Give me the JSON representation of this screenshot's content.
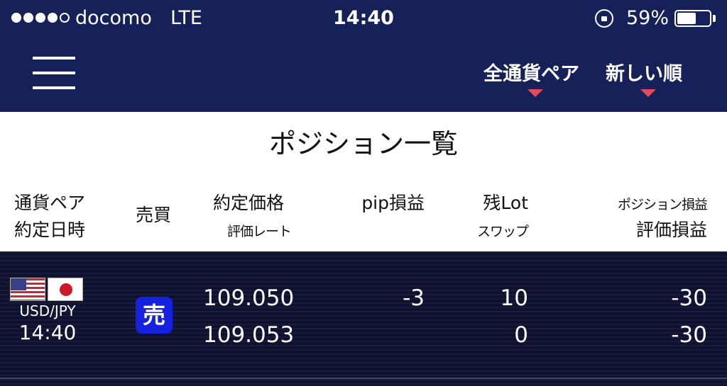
{
  "status_bar": {
    "carrier": "docomo",
    "network": "LTE",
    "time": "14:40",
    "battery_percent": "59%",
    "battery_level": 0.59,
    "signal_bars": 4,
    "signal_max": 5
  },
  "nav": {
    "menu_icon": "hamburger-icon",
    "currency_filter_label": "全通貨ペア",
    "sort_label": "新しい順",
    "dropdown_caret_color": "#e6495e"
  },
  "page": {
    "title": "ポジション一覧"
  },
  "table_header": {
    "pair_line1": "通貨ペア",
    "pair_line2": "約定日時",
    "side": "売買",
    "price_line1": "約定価格",
    "price_line2": "評価レート",
    "pip_pnl": "pip損益",
    "lot_line1": "残Lot",
    "lot_line2": "スワップ",
    "pnl_line1": "ポジション損益",
    "pnl_line2": "評価損益"
  },
  "positions": [
    {
      "pair": "USD/JPY",
      "time": "14:40",
      "side": "売",
      "entry_price": "109.050",
      "eval_rate": "109.053",
      "pip_pnl": "-3",
      "lot": "10",
      "swap": "0",
      "position_pnl": "-30",
      "eval_pnl": "-30",
      "flags": [
        "us-flag-icon",
        "jp-flag-icon"
      ]
    }
  ],
  "colors": {
    "header_bg": "#16215a",
    "list_bg": "#0e1230",
    "sell_badge": "#1422e0"
  }
}
